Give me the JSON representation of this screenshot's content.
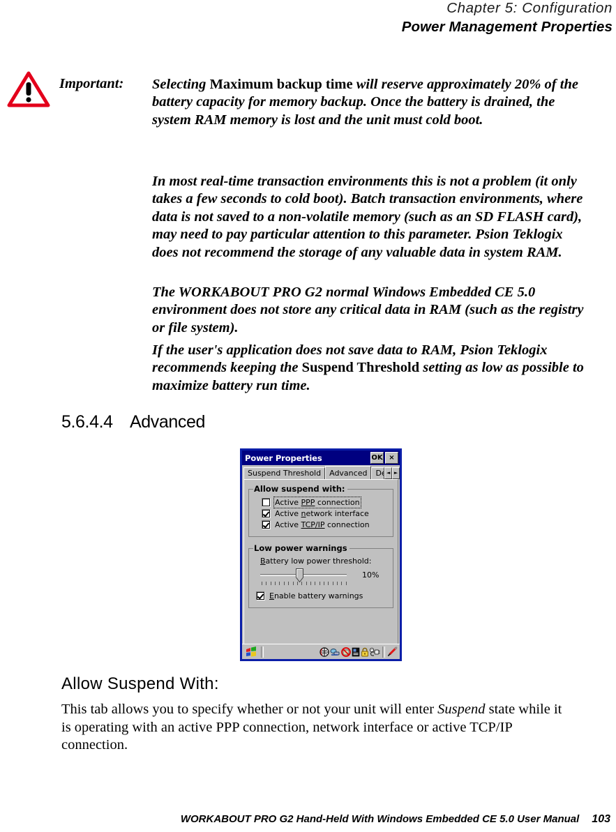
{
  "runhead": {
    "chapter": "Chapter  5:  Configuration",
    "title": "Power Management Properties"
  },
  "important_note": {
    "icon": "warning-triangle-icon",
    "label": "Important:",
    "paragraphs": [
      {
        "segments": [
          {
            "text": "Selecting ",
            "style": "bold-italic"
          },
          {
            "text": "Maximum backup time",
            "style": "bold-roman"
          },
          {
            "text": " will reserve approximately 20% of the battery capacity for memory backup. Once the battery is drained, the system RAM memory is lost and the unit must cold boot.",
            "style": "bold-italic"
          }
        ],
        "plain": "Selecting Maximum backup time will reserve approximately 20% of the battery capacity for memory backup. Once the battery is drained, the system RAM memory is lost and the unit must cold boot."
      },
      {
        "plain": "In most real-time transaction environments this is not a problem (it only takes a few seconds to cold boot). Batch transaction environments, where data is not saved to a non-volatile memory (such as an SD FLASH card), may need to pay particular attention to this parameter. Psion Teklogix does not recommend the storage of any valuable data in system RAM."
      },
      {
        "plain": "The WORKABOUT PRO G2 normal Windows Embedded CE 5.0 environment does not store any critical data in RAM (such as the registry or file system)."
      },
      {
        "segments": [
          {
            "text": "If the user's application does not save data to RAM, Psion Teklogix recommends keeping the ",
            "style": "bold-italic"
          },
          {
            "text": "Suspend Threshold",
            "style": "bold-roman"
          },
          {
            "text": " setting as low as possible to maximize battery run time.",
            "style": "bold-italic"
          }
        ],
        "plain": "If the user's application does not save data to RAM, Psion Teklogix recommends keeping the Suspend Threshold setting as low as possible to maximize battery run time."
      }
    ]
  },
  "section": {
    "number": "5.6.4.4",
    "heading": "Advanced"
  },
  "device_screenshot": {
    "colors": {
      "titlebar": "#000080",
      "window_frame": "#0b1ea8",
      "face": "#c0c0c0",
      "text": "#000000"
    },
    "title_bar": {
      "title": "Power Properties",
      "ok_button": "OK",
      "close_button": "×"
    },
    "tabs": [
      {
        "label": "Suspend Threshold",
        "active": false
      },
      {
        "label": "Advanced",
        "active": true
      },
      {
        "label": "De",
        "active": false,
        "truncated": true
      }
    ],
    "tab_scroll": {
      "left": "◄",
      "right": "►"
    },
    "groups": [
      {
        "legend": "Allow suspend with:",
        "checkboxes": [
          {
            "label": "Active PPP connection",
            "checked": false,
            "focused": true,
            "accel": "PPP"
          },
          {
            "label": "Active network interface",
            "checked": true,
            "focused": false,
            "accel": "n"
          },
          {
            "label": "Active TCP/IP connection",
            "checked": true,
            "focused": false,
            "accel": "TCP/IP"
          }
        ]
      },
      {
        "legend": "Low power warnings",
        "slider_label": "Battery low power threshold:",
        "slider_accel": "B",
        "slider_value": "10%",
        "slider_percent": 45,
        "slider_tick_count": 20,
        "checkboxes": [
          {
            "label": "Enable battery warnings",
            "checked": true,
            "focused": false,
            "accel": "E"
          }
        ]
      }
    ],
    "taskbar": {
      "start_icon": "windows-start-flag-icon",
      "tray_icons": [
        "globe-icon",
        "network-connection-icon",
        "radio-disabled-icon",
        "storage-card-icon",
        "lock-icon",
        "power-plug-icon",
        "stylus-pen-icon"
      ]
    }
  },
  "subsection": {
    "heading": "Allow Suspend With:",
    "body_segments": [
      {
        "text": "This tab allows you to specify whether or not your unit will enter ",
        "style": "roman"
      },
      {
        "text": "Suspend",
        "style": "italic"
      },
      {
        "text": " state while it is operating with an active PPP connection, network interface or active TCP/IP connection.",
        "style": "roman"
      }
    ],
    "body_plain": "This tab allows you to specify whether or not your unit will enter Suspend state while it is operating with an active PPP connection, network interface or active TCP/IP connection."
  },
  "footer": {
    "text": "WORKABOUT PRO G2 Hand-Held With Windows Embedded CE 5.0 User Manual",
    "page_number": "103"
  }
}
